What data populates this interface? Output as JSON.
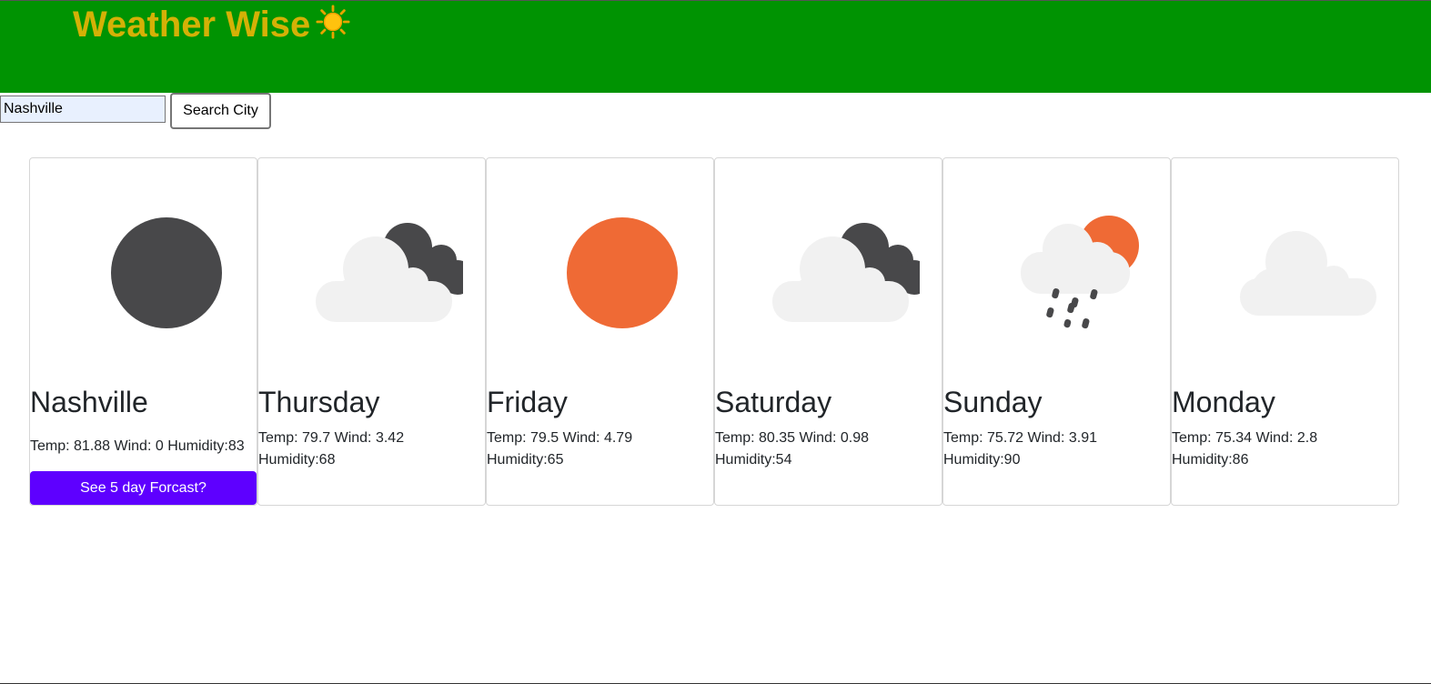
{
  "header": {
    "title": "Weather Wise",
    "title_icon": "☀️"
  },
  "search": {
    "value": "Nashville",
    "button_label": "Search City"
  },
  "current": {
    "icon": "moon-icon",
    "city": "Nashville",
    "stats": "Temp: 81.88 Wind: 0 Humidity:83",
    "forecast_button": "See 5 day Forcast?"
  },
  "forecast": [
    {
      "day": "Thursday",
      "icon": "partly-cloudy-night-icon",
      "stats": "Temp: 79.7 Wind: 3.42 Humidity:68"
    },
    {
      "day": "Friday",
      "icon": "sun-icon",
      "stats": "Temp: 79.5 Wind: 4.79 Humidity:65"
    },
    {
      "day": "Saturday",
      "icon": "partly-cloudy-night-icon",
      "stats": "Temp: 80.35 Wind: 0.98 Humidity:54"
    },
    {
      "day": "Sunday",
      "icon": "rain-sun-icon",
      "stats": "Temp: 75.72 Wind: 3.91 Humidity:90"
    },
    {
      "day": "Monday",
      "icon": "cloud-icon",
      "stats": "Temp: 75.34 Wind: 2.8 Humidity:86"
    }
  ],
  "colors": {
    "header_bg": "#009302",
    "title": "#d4b106",
    "button_bg": "#5e00ff",
    "sun": "#ef6a35",
    "moon": "#48484a",
    "cloud": "#f1f1f1"
  }
}
